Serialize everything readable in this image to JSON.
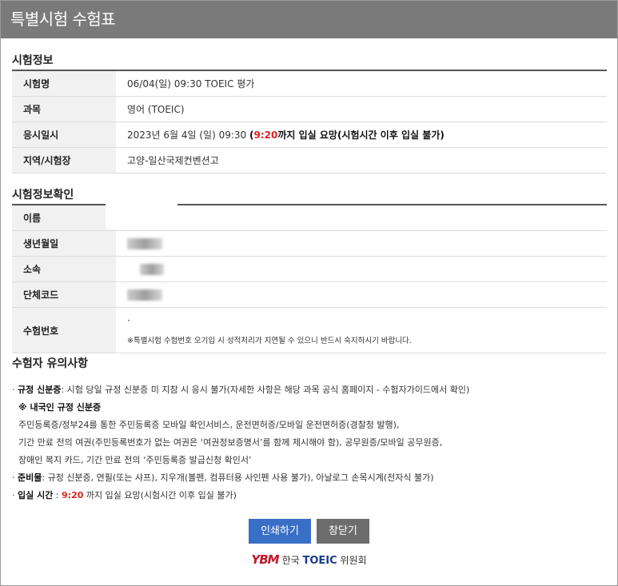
{
  "window": {
    "title": "특별시험 수험표"
  },
  "exam_info": {
    "heading": "시험정보",
    "rows": [
      {
        "label": "시험명",
        "value": "06/04(일) 09:30 TOEIC 평가"
      },
      {
        "label": "과목",
        "value": "영어 (TOEIC)"
      },
      {
        "label": "응시일시",
        "value_prefix": "2023년 6월 4일 (일) 09:30 ",
        "value_open": "(",
        "value_red": "9:20",
        "value_bold": "까지 입실 요망(시험시간 이후 입실 불가)"
      },
      {
        "label": "지역/시험장",
        "value": "고양-일산국제컨벤션고"
      }
    ]
  },
  "confirm_info": {
    "heading": "시험정보확인",
    "rows": [
      {
        "label": "이름"
      },
      {
        "label": "생년월일"
      },
      {
        "label": "소속"
      },
      {
        "label": "단체코드"
      },
      {
        "label": "수험번호",
        "value": "·",
        "note": "※특별시험 수험번호 오기입 시 성적처리가 지연될 수 있으니 반드시 숙지하시기 바랍니다."
      }
    ]
  },
  "notices": {
    "heading": "수험자 유의사항",
    "id_label": "규정 신분증",
    "id_text": ": 시험 당일 규정 신분증 미 지참 시 응시 불가(자세한 사항은 해당 과목 공식 홈페이지 - 수험자가이드에서 확인)",
    "domestic_title": "※ 내국인 규정 신분증",
    "domestic_lines": [
      "주민등록증/정부24를 통한 주민등록증 모바일 확인서비스, 운전면허증/모바일 운전면허증(경찰청 발행),",
      "기간 만료 전의 여권(주민등록번호가 없는 여권은 ‘여권정보증명서’를 함께 제시해야 함), 공무원증/모바일 공무원증,",
      "장애인 복지 카드, 기간 만료 전의 ‘주민등록증 발급신청 확인서’"
    ],
    "supplies_label": "준비물",
    "supplies_text": ": 규정 신분증, 연필(또는 샤프), 지우개(볼펜, 컴퓨터용 사인펜 사용 불가), 아날로그 손목시계(전자식 불가)",
    "entry_label": "입실 시간",
    "entry_sep": " : ",
    "entry_red": "9:20",
    "entry_text": " 까지 입실 요망(시험시간 이후 입실 불가)"
  },
  "buttons": {
    "print": "인쇄하기",
    "close": "창닫기"
  },
  "footer": {
    "logo_mark": "YBM",
    "org_prefix": "한국 ",
    "org_brand": "TOEIC",
    "org_suffix": " 위원회"
  },
  "colors": {
    "accent_red": "#e02020",
    "print_button": "#3a6fc7",
    "close_button": "#6d6d6d",
    "titlebar": "#7a7a7a"
  }
}
